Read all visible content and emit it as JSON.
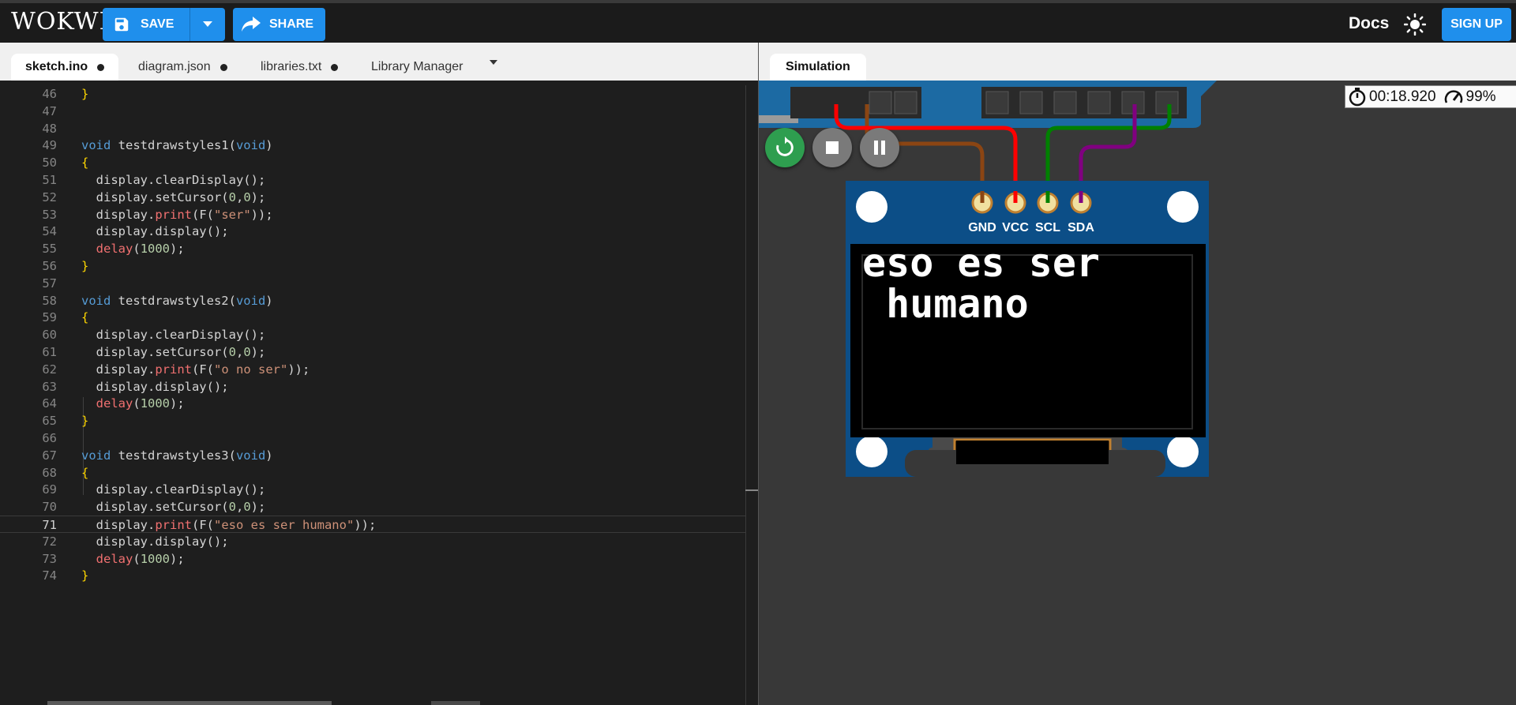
{
  "app": {
    "logo": "WOKWI",
    "save_label": "SAVE",
    "share_label": "SHARE",
    "docs_label": "Docs",
    "signup_label": "SIGN UP"
  },
  "editor": {
    "tabs": [
      {
        "label": "sketch.ino",
        "modified": true
      },
      {
        "label": "diagram.json",
        "modified": true
      },
      {
        "label": "libraries.txt",
        "modified": true
      },
      {
        "label": "Library Manager",
        "modified": false
      }
    ],
    "current_line": 71,
    "lines": [
      {
        "n": "46",
        "code": "}"
      },
      {
        "n": "47",
        "code": ""
      },
      {
        "n": "48",
        "code": ""
      },
      {
        "n": "49",
        "code": "void testdrawstyles1(void)"
      },
      {
        "n": "50",
        "code": "{"
      },
      {
        "n": "51",
        "code": "  display.clearDisplay();"
      },
      {
        "n": "52",
        "code": "  display.setCursor(0,0);"
      },
      {
        "n": "53",
        "code": "  display.print(F(\"ser\"));"
      },
      {
        "n": "54",
        "code": "  display.display();"
      },
      {
        "n": "55",
        "code": "  delay(1000);"
      },
      {
        "n": "56",
        "code": "}"
      },
      {
        "n": "57",
        "code": ""
      },
      {
        "n": "58",
        "code": "void testdrawstyles2(void)"
      },
      {
        "n": "59",
        "code": "{"
      },
      {
        "n": "60",
        "code": "  display.clearDisplay();"
      },
      {
        "n": "61",
        "code": "  display.setCursor(0,0);"
      },
      {
        "n": "62",
        "code": "  display.print(F(\"o no ser\"));"
      },
      {
        "n": "63",
        "code": "  display.display();"
      },
      {
        "n": "64",
        "code": "  delay(1000);"
      },
      {
        "n": "65",
        "code": "}"
      },
      {
        "n": "66",
        "code": ""
      },
      {
        "n": "67",
        "code": "void testdrawstyles3(void)"
      },
      {
        "n": "68",
        "code": "{"
      },
      {
        "n": "69",
        "code": "  display.clearDisplay();"
      },
      {
        "n": "70",
        "code": "  display.setCursor(0,0);"
      },
      {
        "n": "71",
        "code": "  display.print(F(\"eso es ser humano\"));"
      },
      {
        "n": "72",
        "code": "  display.display();"
      },
      {
        "n": "73",
        "code": "  delay(1000);"
      },
      {
        "n": "74",
        "code": "}"
      }
    ]
  },
  "simulation": {
    "tab_label": "Simulation",
    "elapsed_time": "00:18.920",
    "speed": "99%",
    "oled": {
      "pins": [
        "GND",
        "VCC",
        "SCL",
        "SDA"
      ],
      "line1": "eso es ser",
      "line2": " humano"
    },
    "wire_colors": {
      "gnd": "#8b4513",
      "vcc": "#ff0000",
      "scl": "#008000",
      "sda": "#800080"
    },
    "colors": {
      "accent": "#1f8fec",
      "board": "#0c4e87",
      "restart": "#2e9e4f"
    }
  }
}
